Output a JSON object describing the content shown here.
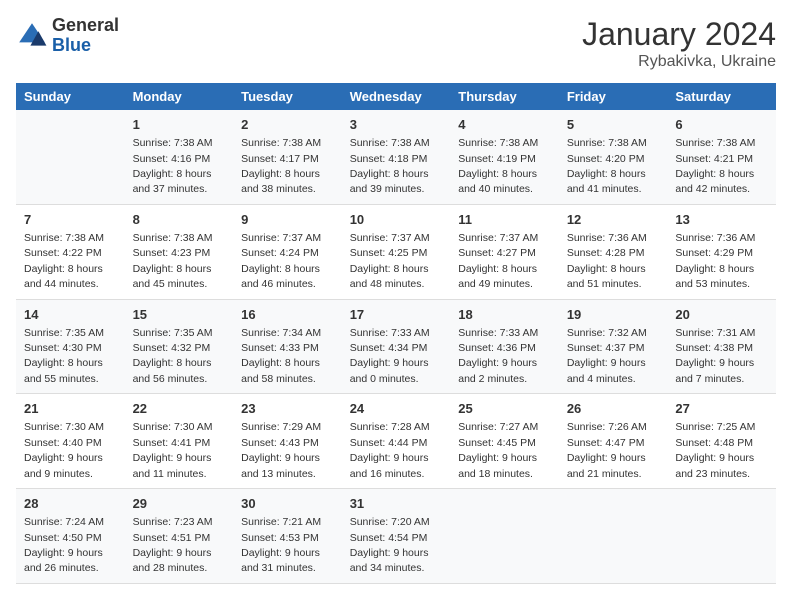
{
  "header": {
    "logo_general": "General",
    "logo_blue": "Blue",
    "month_year": "January 2024",
    "location": "Rybakivka, Ukraine"
  },
  "days_of_week": [
    "Sunday",
    "Monday",
    "Tuesday",
    "Wednesday",
    "Thursday",
    "Friday",
    "Saturday"
  ],
  "weeks": [
    [
      {
        "day": "",
        "sunrise": "",
        "sunset": "",
        "daylight": ""
      },
      {
        "day": "1",
        "sunrise": "Sunrise: 7:38 AM",
        "sunset": "Sunset: 4:16 PM",
        "daylight": "Daylight: 8 hours and 37 minutes."
      },
      {
        "day": "2",
        "sunrise": "Sunrise: 7:38 AM",
        "sunset": "Sunset: 4:17 PM",
        "daylight": "Daylight: 8 hours and 38 minutes."
      },
      {
        "day": "3",
        "sunrise": "Sunrise: 7:38 AM",
        "sunset": "Sunset: 4:18 PM",
        "daylight": "Daylight: 8 hours and 39 minutes."
      },
      {
        "day": "4",
        "sunrise": "Sunrise: 7:38 AM",
        "sunset": "Sunset: 4:19 PM",
        "daylight": "Daylight: 8 hours and 40 minutes."
      },
      {
        "day": "5",
        "sunrise": "Sunrise: 7:38 AM",
        "sunset": "Sunset: 4:20 PM",
        "daylight": "Daylight: 8 hours and 41 minutes."
      },
      {
        "day": "6",
        "sunrise": "Sunrise: 7:38 AM",
        "sunset": "Sunset: 4:21 PM",
        "daylight": "Daylight: 8 hours and 42 minutes."
      }
    ],
    [
      {
        "day": "7",
        "sunrise": "Sunrise: 7:38 AM",
        "sunset": "Sunset: 4:22 PM",
        "daylight": "Daylight: 8 hours and 44 minutes."
      },
      {
        "day": "8",
        "sunrise": "Sunrise: 7:38 AM",
        "sunset": "Sunset: 4:23 PM",
        "daylight": "Daylight: 8 hours and 45 minutes."
      },
      {
        "day": "9",
        "sunrise": "Sunrise: 7:37 AM",
        "sunset": "Sunset: 4:24 PM",
        "daylight": "Daylight: 8 hours and 46 minutes."
      },
      {
        "day": "10",
        "sunrise": "Sunrise: 7:37 AM",
        "sunset": "Sunset: 4:25 PM",
        "daylight": "Daylight: 8 hours and 48 minutes."
      },
      {
        "day": "11",
        "sunrise": "Sunrise: 7:37 AM",
        "sunset": "Sunset: 4:27 PM",
        "daylight": "Daylight: 8 hours and 49 minutes."
      },
      {
        "day": "12",
        "sunrise": "Sunrise: 7:36 AM",
        "sunset": "Sunset: 4:28 PM",
        "daylight": "Daylight: 8 hours and 51 minutes."
      },
      {
        "day": "13",
        "sunrise": "Sunrise: 7:36 AM",
        "sunset": "Sunset: 4:29 PM",
        "daylight": "Daylight: 8 hours and 53 minutes."
      }
    ],
    [
      {
        "day": "14",
        "sunrise": "Sunrise: 7:35 AM",
        "sunset": "Sunset: 4:30 PM",
        "daylight": "Daylight: 8 hours and 55 minutes."
      },
      {
        "day": "15",
        "sunrise": "Sunrise: 7:35 AM",
        "sunset": "Sunset: 4:32 PM",
        "daylight": "Daylight: 8 hours and 56 minutes."
      },
      {
        "day": "16",
        "sunrise": "Sunrise: 7:34 AM",
        "sunset": "Sunset: 4:33 PM",
        "daylight": "Daylight: 8 hours and 58 minutes."
      },
      {
        "day": "17",
        "sunrise": "Sunrise: 7:33 AM",
        "sunset": "Sunset: 4:34 PM",
        "daylight": "Daylight: 9 hours and 0 minutes."
      },
      {
        "day": "18",
        "sunrise": "Sunrise: 7:33 AM",
        "sunset": "Sunset: 4:36 PM",
        "daylight": "Daylight: 9 hours and 2 minutes."
      },
      {
        "day": "19",
        "sunrise": "Sunrise: 7:32 AM",
        "sunset": "Sunset: 4:37 PM",
        "daylight": "Daylight: 9 hours and 4 minutes."
      },
      {
        "day": "20",
        "sunrise": "Sunrise: 7:31 AM",
        "sunset": "Sunset: 4:38 PM",
        "daylight": "Daylight: 9 hours and 7 minutes."
      }
    ],
    [
      {
        "day": "21",
        "sunrise": "Sunrise: 7:30 AM",
        "sunset": "Sunset: 4:40 PM",
        "daylight": "Daylight: 9 hours and 9 minutes."
      },
      {
        "day": "22",
        "sunrise": "Sunrise: 7:30 AM",
        "sunset": "Sunset: 4:41 PM",
        "daylight": "Daylight: 9 hours and 11 minutes."
      },
      {
        "day": "23",
        "sunrise": "Sunrise: 7:29 AM",
        "sunset": "Sunset: 4:43 PM",
        "daylight": "Daylight: 9 hours and 13 minutes."
      },
      {
        "day": "24",
        "sunrise": "Sunrise: 7:28 AM",
        "sunset": "Sunset: 4:44 PM",
        "daylight": "Daylight: 9 hours and 16 minutes."
      },
      {
        "day": "25",
        "sunrise": "Sunrise: 7:27 AM",
        "sunset": "Sunset: 4:45 PM",
        "daylight": "Daylight: 9 hours and 18 minutes."
      },
      {
        "day": "26",
        "sunrise": "Sunrise: 7:26 AM",
        "sunset": "Sunset: 4:47 PM",
        "daylight": "Daylight: 9 hours and 21 minutes."
      },
      {
        "day": "27",
        "sunrise": "Sunrise: 7:25 AM",
        "sunset": "Sunset: 4:48 PM",
        "daylight": "Daylight: 9 hours and 23 minutes."
      }
    ],
    [
      {
        "day": "28",
        "sunrise": "Sunrise: 7:24 AM",
        "sunset": "Sunset: 4:50 PM",
        "daylight": "Daylight: 9 hours and 26 minutes."
      },
      {
        "day": "29",
        "sunrise": "Sunrise: 7:23 AM",
        "sunset": "Sunset: 4:51 PM",
        "daylight": "Daylight: 9 hours and 28 minutes."
      },
      {
        "day": "30",
        "sunrise": "Sunrise: 7:21 AM",
        "sunset": "Sunset: 4:53 PM",
        "daylight": "Daylight: 9 hours and 31 minutes."
      },
      {
        "day": "31",
        "sunrise": "Sunrise: 7:20 AM",
        "sunset": "Sunset: 4:54 PM",
        "daylight": "Daylight: 9 hours and 34 minutes."
      },
      {
        "day": "",
        "sunrise": "",
        "sunset": "",
        "daylight": ""
      },
      {
        "day": "",
        "sunrise": "",
        "sunset": "",
        "daylight": ""
      },
      {
        "day": "",
        "sunrise": "",
        "sunset": "",
        "daylight": ""
      }
    ]
  ]
}
